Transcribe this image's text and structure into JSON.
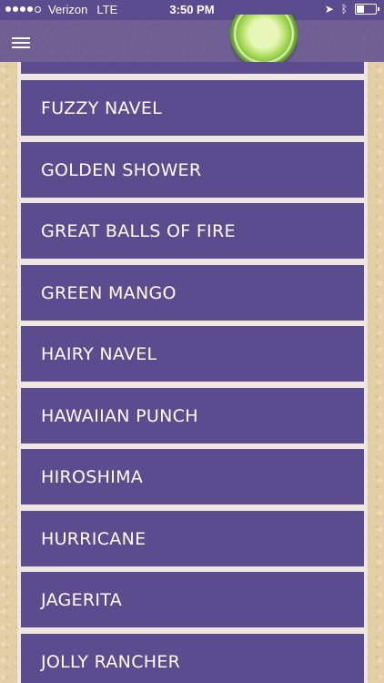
{
  "status_bar": {
    "carrier": "Verizon",
    "network": "LTE",
    "time": "3:50 PM"
  },
  "nav": {
    "menu_icon": "hamburger-menu-icon",
    "decoration": "lime-slice"
  },
  "colors": {
    "purple": "#5b4b8f",
    "sand": "#e3cfa5",
    "divider": "#efe6df"
  },
  "cocktails": [
    "FUZZY NAVEL",
    "GOLDEN SHOWER",
    "GREAT BALLS OF FIRE",
    "GREEN MANGO",
    "HAIRY NAVEL",
    "HAWAIIAN PUNCH",
    "HIROSHIMA",
    "HURRICANE",
    "JAGERITA",
    "JOLLY RANCHER"
  ]
}
